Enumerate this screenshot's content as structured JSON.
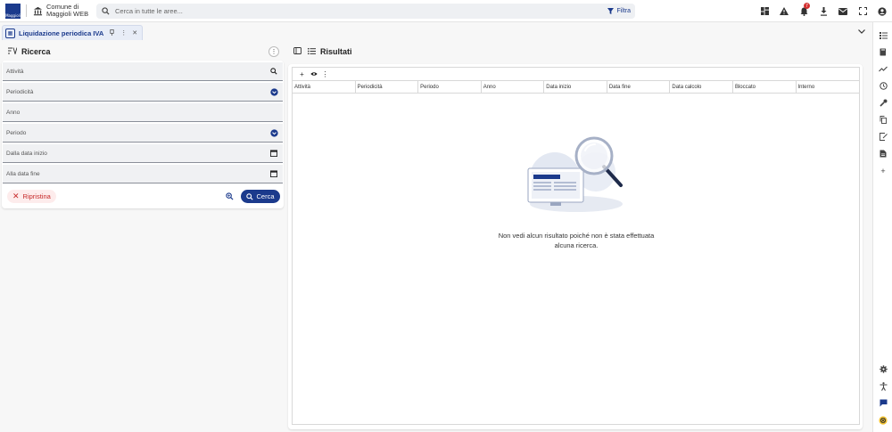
{
  "topbar": {
    "logo_text": "Maggioli",
    "org_name": "Comune di Maggioli WEB",
    "search_placeholder": "Cerca in tutte le aree...",
    "filter_label": "Filtra",
    "notification_count": "7",
    "icons": [
      "dashboard-icon",
      "warning-icon",
      "bell-icon",
      "download-icon",
      "mail-icon",
      "fullscreen-icon",
      "account-icon"
    ]
  },
  "tabs": [
    {
      "label": "Liquidazione periodica IVA"
    }
  ],
  "search_panel": {
    "title": "Ricerca",
    "fields": [
      {
        "label": "Attività",
        "icon": "search-icon"
      },
      {
        "label": "Periodicità",
        "icon": "dropdown-icon"
      },
      {
        "label": "Anno",
        "icon": ""
      },
      {
        "label": "Periodo",
        "icon": "dropdown-icon"
      },
      {
        "label": "Dalla data inizio",
        "icon": "calendar-icon"
      },
      {
        "label": "Alla data fine",
        "icon": "calendar-icon"
      }
    ],
    "reset_label": "Ripristina",
    "search_label": "Cerca"
  },
  "results_panel": {
    "title": "Risultati",
    "columns": [
      "Attività",
      "Periodicità",
      "Periodo",
      "Anno",
      "Data inizio",
      "Data fine",
      "Data calcolo",
      "Bloccato",
      "Interno"
    ],
    "empty_line1": "Non vedi alcun risultato poiché non è stata effettuata",
    "empty_line2": "alcuna ricerca."
  },
  "colors": {
    "primary": "#1b3a8c",
    "danger": "#c62828",
    "reset_bg": "#fdecec"
  }
}
